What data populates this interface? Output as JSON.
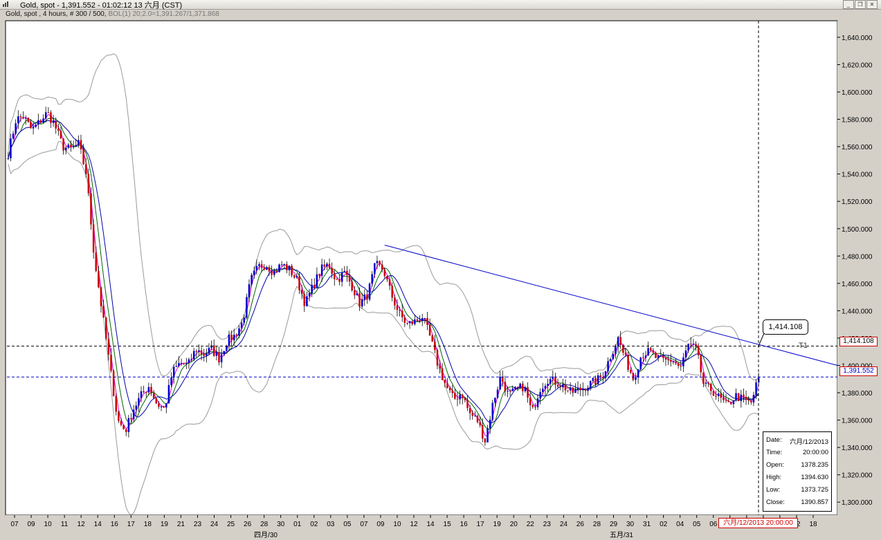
{
  "window": {
    "title": "Gold, spot - 1,391.552 - 01:02:12  13 六月 (CST)",
    "subtitle": "Gold, spot , 4 hours, # 300 / 500,",
    "indicator": "BOL(1) 20;2.0=1,391.267/1,371.868",
    "buttons": [
      "_",
      "❐",
      "✕"
    ]
  },
  "callout_label": "1,414.108",
  "trendline_label": "T1",
  "price_boxes": {
    "resistance": "1,414.108",
    "current": "1,391.552"
  },
  "info_panel": [
    {
      "key": "Date:",
      "value": "六月/12/2013"
    },
    {
      "key": "Time:",
      "value": "20:00:00"
    },
    {
      "key": "Open:",
      "value": "1378.235"
    },
    {
      "key": "High:",
      "value": "1394.630"
    },
    {
      "key": "Low:",
      "value": "1373.725"
    },
    {
      "key": "Close:",
      "value": "1390.857"
    }
  ],
  "cursor_date_label": "六月/12/2013  20:00:00",
  "colors": {
    "up": "#0000cc",
    "down": "#cc0000",
    "bollinger": "#999999",
    "ma_fast": "#e000e0",
    "ma_mid": "#006600",
    "ma_slow": "#0000aa",
    "trendline": "#0000cc"
  },
  "chart_data": {
    "type": "candlestick",
    "title": "Gold, spot",
    "ylim": [
      1290,
      1650
    ],
    "y_ticks": [
      "1,300.000",
      "1,320.000",
      "1,340.000",
      "1,360.000",
      "1,380.000",
      "1,400.000",
      "1,420.000",
      "1,440.000",
      "1,460.000",
      "1,480.000",
      "1,500.000",
      "1,520.000",
      "1,540.000",
      "1,560.000",
      "1,580.000",
      "1,600.000",
      "1,620.000",
      "1,640.000"
    ],
    "y_tick_values": [
      1300,
      1320,
      1340,
      1360,
      1380,
      1400,
      1420,
      1440,
      1460,
      1480,
      1500,
      1520,
      1540,
      1560,
      1580,
      1600,
      1620,
      1640
    ],
    "x_ticks": [
      "07",
      "09",
      "10",
      "11",
      "12",
      "14",
      "16",
      "17",
      "18",
      "19",
      "21",
      "23",
      "24",
      "25",
      "26",
      "28",
      "30",
      "01",
      "02",
      "03",
      "05",
      "07",
      "09",
      "10",
      "12",
      "14",
      "15",
      "16",
      "17",
      "19",
      "20",
      "22",
      "23",
      "24",
      "26",
      "28",
      "29",
      "30",
      "31",
      "02",
      "04",
      "05",
      "06",
      "07",
      "09",
      "10",
      "11",
      "12",
      "18"
    ],
    "x_month_labels": [
      "四月/30",
      "五月/31"
    ],
    "horizontal_lines": [
      1414.108,
      1391.552
    ],
    "trendline": {
      "from": 1488,
      "to": 1400
    },
    "series": [
      {
        "name": "Gold, spot",
        "close_path": [
          1555,
          1580,
          1582,
          1572,
          1578,
          1585,
          1575,
          1560,
          1558,
          1562,
          1540,
          1480,
          1440,
          1400,
          1360,
          1352,
          1368,
          1378,
          1385,
          1372,
          1368,
          1395,
          1402,
          1400,
          1412,
          1408,
          1412,
          1405,
          1418,
          1422,
          1432,
          1462,
          1472,
          1474,
          1468,
          1474,
          1470,
          1462,
          1445,
          1458,
          1470,
          1474,
          1462,
          1468,
          1458,
          1445,
          1452,
          1474,
          1470,
          1452,
          1438,
          1430,
          1432,
          1436,
          1420,
          1400,
          1385,
          1375,
          1380,
          1365,
          1360,
          1345,
          1372,
          1392,
          1378,
          1382,
          1385,
          1365,
          1383,
          1390,
          1388,
          1385,
          1380,
          1382,
          1385,
          1388,
          1392,
          1406,
          1420,
          1404,
          1390,
          1408,
          1410,
          1405,
          1403,
          1404,
          1398,
          1415,
          1412,
          1385,
          1382,
          1376,
          1370,
          1378,
          1375,
          1372,
          1391
        ]
      }
    ]
  }
}
